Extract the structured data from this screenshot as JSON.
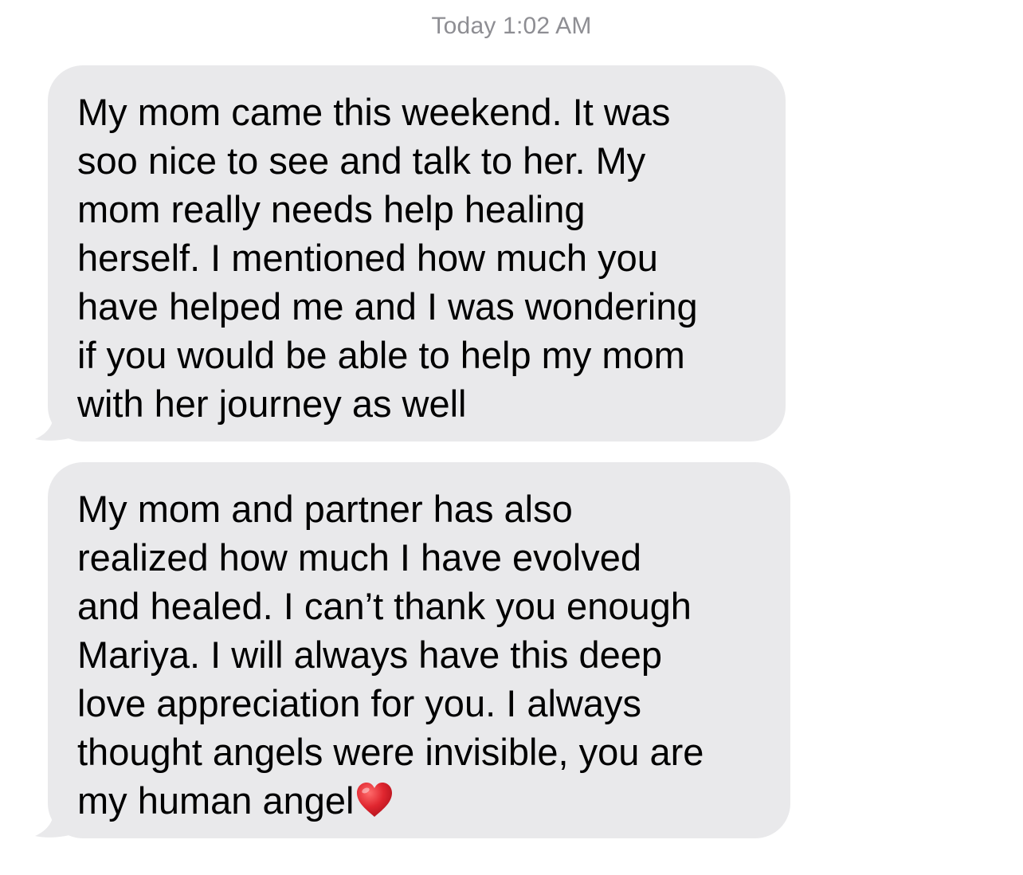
{
  "thread": {
    "timestamp": "Today 1:02 AM",
    "messages": [
      {
        "direction": "incoming",
        "text": "My mom came this weekend. It was\nsoo nice to see and talk to her. My\nmom really needs help healing\nherself. I mentioned how much you\nhave helped me and I was wondering\nif you would be able to help my mom\nwith her journey as well"
      },
      {
        "direction": "incoming",
        "text": "My mom and partner has also\nrealized how much I have evolved\nand healed. I can’t thank you enough\nMariya. I will always have this deep\nlove appreciation  for you. I always\nthought angels were invisible, you are\nmy human angel",
        "trailing_emoji": "heart-emoji"
      }
    ]
  },
  "colors": {
    "bubble_incoming": "#e9e9eb",
    "timestamp_text": "#8e8e93",
    "heart": "#e0262f"
  }
}
